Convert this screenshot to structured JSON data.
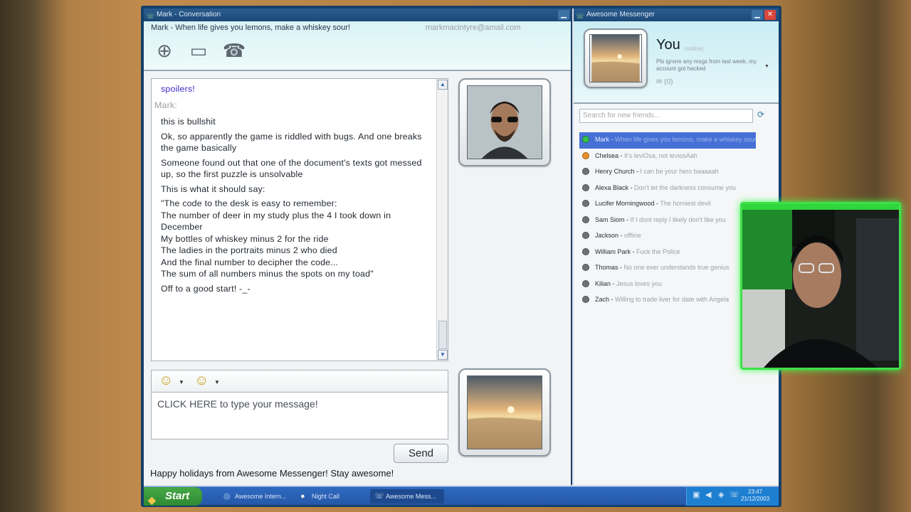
{
  "conversation": {
    "title": "Mark - Conversation",
    "status_text": "Mark - When life gives you lemons, make a whiskey sour!",
    "email": "markmacintyre@amail.com",
    "messages": [
      {
        "type": "msg",
        "text": "spoilers!",
        "style": "purple"
      },
      {
        "type": "sender",
        "text": "Mark:"
      },
      {
        "type": "msg",
        "text": "this is bullshit"
      },
      {
        "type": "msg",
        "text": "Ok, so apparently the game is riddled with bugs. And one breaks the game basically"
      },
      {
        "type": "msg",
        "text": "Someone found out that one of the document's texts got messed up, so the first puzzle is unsolvable"
      },
      {
        "type": "msg",
        "text": "This is what it should say:"
      },
      {
        "type": "msg",
        "text": "\"The code to the desk is easy to remember:"
      },
      {
        "type": "cont",
        "text": "The number of deer in my study plus the 4 I took down in December"
      },
      {
        "type": "cont",
        "text": "My bottles of whiskey minus 2 for the ride"
      },
      {
        "type": "cont",
        "text": "The ladies in the portraits minus 2 who died"
      },
      {
        "type": "cont",
        "text": "And the final number to decipher the code..."
      },
      {
        "type": "cont",
        "text": "The sum of all numbers minus the spots on my toad\""
      },
      {
        "type": "msg",
        "text": "Off to a good start! -_-"
      }
    ],
    "input_placeholder": "CLICK HERE to type your message!",
    "send_label": "Send",
    "footer": "Happy holidays from Awesome Messenger! Stay awesome!"
  },
  "messenger": {
    "title": "Awesome Messenger",
    "you_label": "You",
    "online_label": "(online)",
    "personal_message": "Pls ignore any msgs from last week, my account got hacked",
    "count_label": "(0)",
    "search_placeholder": "Search for new friends...",
    "contacts": [
      {
        "name": "Mark",
        "message": "When life gives you lemons, make a whiskey sour!",
        "status": "online",
        "selected": true
      },
      {
        "name": "Chelsea",
        "message": "It's leviOsa, not leviosAah",
        "status": "away"
      },
      {
        "name": "Henry Church",
        "message": "I can be your hero baaaaah",
        "status": "offline"
      },
      {
        "name": "Alexa Black",
        "message": "Don't let the darkness consume you",
        "status": "offline"
      },
      {
        "name": "Lucifer Morningwood",
        "message": "The horniest devil",
        "status": "offline"
      },
      {
        "name": "Sam Siom",
        "message": "If I dont reply I likely don't like you",
        "status": "offline"
      },
      {
        "name": "Jackson",
        "message": "offline",
        "status": "offline"
      },
      {
        "name": "William Park",
        "message": "Fuck the Police",
        "status": "offline"
      },
      {
        "name": "Thomas",
        "message": "No one ever understands true genius",
        "status": "offline"
      },
      {
        "name": "Kilian",
        "message": "Jesus loves you",
        "status": "offline"
      },
      {
        "name": "Zach",
        "message": "Willing to trade liver for date with Angela",
        "status": "offline"
      }
    ]
  },
  "taskbar": {
    "start_label": "Start",
    "tasks": [
      {
        "label": "Awesome Intern..."
      },
      {
        "label": "Night Call"
      },
      {
        "label": "Awesome Mess..."
      }
    ],
    "time": "23:47",
    "date": "21/12/2003"
  },
  "colors": {
    "titlebar": "#1c4977",
    "selected_contact": "#4670d6",
    "taskbar": "#2457a8",
    "start_button": "#3a9a3c",
    "webcam_border": "#3fe04a"
  }
}
